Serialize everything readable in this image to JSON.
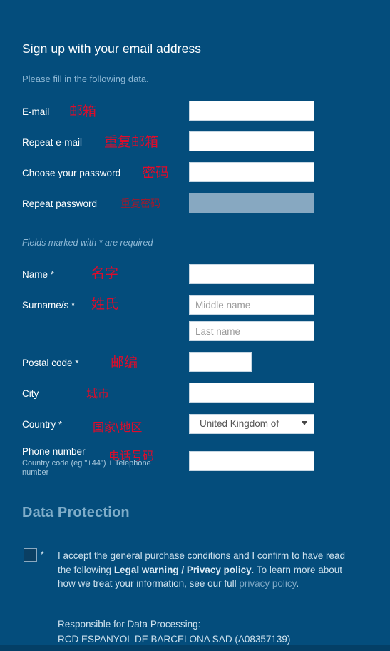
{
  "form": {
    "title": "Sign up with your email address",
    "subtitle": "Please fill in the following data.",
    "required_note": "Fields marked with * are required"
  },
  "fields": {
    "email": {
      "label": "E-mail",
      "annotation_cn": "邮箱",
      "value": "",
      "placeholder": ""
    },
    "repeat_email": {
      "label": "Repeat e-mail",
      "annotation_cn": "重复邮箱",
      "value": "",
      "placeholder": ""
    },
    "password": {
      "label": "Choose your password",
      "annotation_cn": "密码",
      "value": "",
      "placeholder": ""
    },
    "repeat_password": {
      "label": "Repeat password",
      "annotation_cn": "重复密码",
      "value": "",
      "placeholder": "",
      "state": "disabled"
    },
    "name": {
      "label": "Name",
      "required_mark": "*",
      "annotation_cn": "名字",
      "value": "",
      "placeholder": ""
    },
    "surname": {
      "label": "Surname/s",
      "required_mark": "*",
      "annotation_cn": "姓氏",
      "middle_value": "",
      "middle_placeholder": "Middle name",
      "last_value": "",
      "last_placeholder": "Last name"
    },
    "postal_code": {
      "label": "Postal code",
      "required_mark": "*",
      "annotation_cn": "邮编",
      "value": "",
      "placeholder": ""
    },
    "city": {
      "label": "City",
      "annotation_cn": "城市",
      "value": "",
      "placeholder": ""
    },
    "country": {
      "label": "Country",
      "required_mark": "*",
      "annotation_cn": "国家\\地区",
      "selected": "United Kingdom of"
    },
    "phone": {
      "label": "Phone number",
      "hint": "Country code (eg \"+44\") + Telephone number",
      "annotation_cn": "电话号码",
      "value": "",
      "placeholder": ""
    }
  },
  "data_protection": {
    "heading": "Data Protection",
    "required_mark": "*",
    "consent": {
      "part1": "I accept the general purchase conditions and I confirm to have read the following ",
      "legal_warning": "Legal warning",
      "separator": " / ",
      "privacy_policy": "Privacy policy",
      "part2": ". To learn more about how we treat your information, see our full ",
      "privacy_policy_link": "privacy policy",
      "part3": "."
    },
    "responsible_label": "Responsible for Data Processing:",
    "responsible_entity": "RCD ESPANYOL DE BARCELONA SAD (A08357139)"
  },
  "colors": {
    "background": "#044d7c",
    "annotation_red": "#e00b2a",
    "muted_blue": "#8fb9d6",
    "section_heading": "#7fadc9",
    "field_disabled": "#87a8c1"
  }
}
